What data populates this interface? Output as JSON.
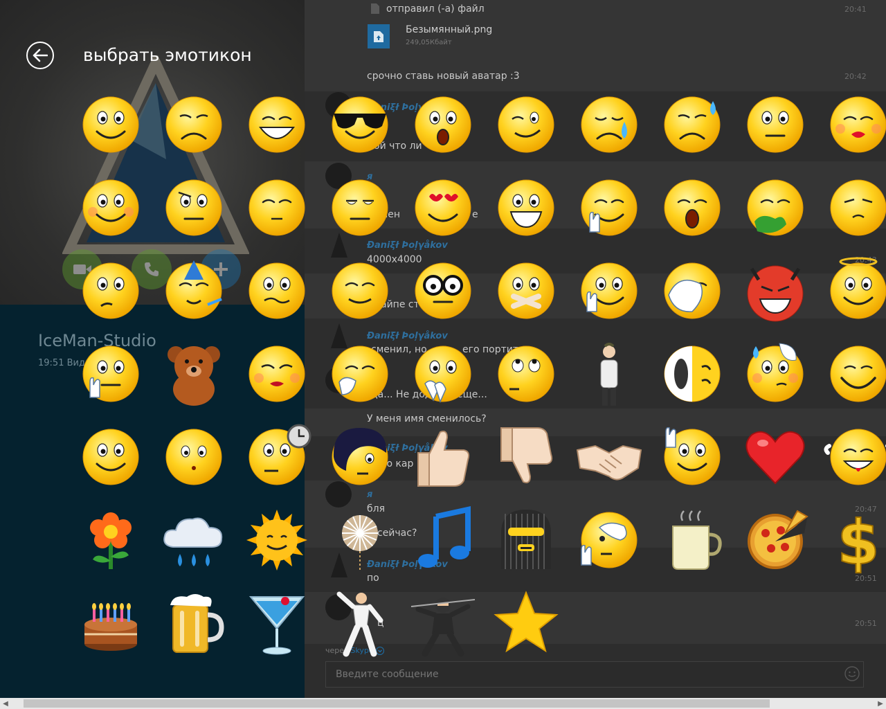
{
  "picker": {
    "title": "выбрать эмотикон",
    "emoticons": [
      "smile",
      "sad",
      "laugh",
      "cool",
      "surprised",
      "wink",
      "cry",
      "sweat",
      "speechless",
      "kiss",
      "blush",
      "wondering",
      "sleepy",
      "dull",
      "in-love",
      "evil-grin",
      "fingers-crossed",
      "yawn",
      "puke",
      "doh",
      "thinking",
      "party",
      "worried",
      "relieved",
      "nerd",
      "lips-sealed",
      "hi",
      "facepalm",
      "devil",
      "angel",
      "hush",
      "bear",
      "flirt",
      "giggle",
      "clap",
      "rolling-eyes",
      "bow",
      "half-face",
      "sweating-shy",
      "big-smile",
      "happy",
      "pondering",
      "waiting",
      "emo",
      "thumbs-up",
      "thumbs-down",
      "handshake",
      "wave",
      "heart",
      "rofl",
      "flower",
      "rain",
      "sun",
      "fireworks",
      "music",
      "bandit",
      "nod",
      "coffee",
      "pizza",
      "cash",
      "cake",
      "beer",
      "drink",
      "dance",
      "ninja",
      "star"
    ]
  },
  "contact": {
    "name": "IceMan-Studio",
    "status": "19:51 Виде"
  },
  "chat": {
    "messages": [
      {
        "id": "m1",
        "text": "отправил (-а) файл",
        "time": "20:41"
      },
      {
        "id": "m2",
        "text": "Безымянный.png",
        "sub": "249,05Кбайт"
      },
      {
        "id": "m3",
        "text": "срочно ставь новый аватар :3",
        "time": "20:42"
      },
      {
        "id": "m4",
        "author": "Đaniξł Þoļγåkov",
        "text": "ой что ли"
      },
      {
        "id": "m5",
        "author": "я",
        "text": "й"
      },
      {
        "id": "m6",
        "text": "решен",
        "text2": "е"
      },
      {
        "id": "m7",
        "author": "Đaniξł Þoļγåkov",
        "text": "4000x4000",
        "time": "20:43"
      },
      {
        "id": "m8",
        "text": "айпе ст"
      },
      {
        "id": "m9",
        "author": "Đaniξł Þoļγåkov",
        "text": "сменил, но",
        "text2": "его портит"
      },
      {
        "id": "m10",
        "text": "да... Не дод",
        "text2": "еще..."
      },
      {
        "id": "m11",
        "text": "У меня имя сменилось?"
      },
      {
        "id": "m12",
        "author": "Đaniξł Þoļγåkov",
        "text": "ко кар"
      },
      {
        "id": "m13",
        "author": "я",
        "text": "бля",
        "time": "20:47"
      },
      {
        "id": "m14",
        "text": "сейчас?"
      },
      {
        "id": "m15",
        "author": "Đaniξł Þoļγåkov",
        "text": "по",
        "time": "20:51"
      },
      {
        "id": "m16",
        "author": "я",
        "text": "ц",
        "time": "20:51"
      }
    ],
    "via_prefix": "через",
    "via_service": "Skype",
    "input_placeholder": "Введите сообщение"
  },
  "colors": {
    "accent": "#1e6fa8",
    "left_bottom": "#05222f",
    "emoticon_yellow": "#ffd21f"
  }
}
